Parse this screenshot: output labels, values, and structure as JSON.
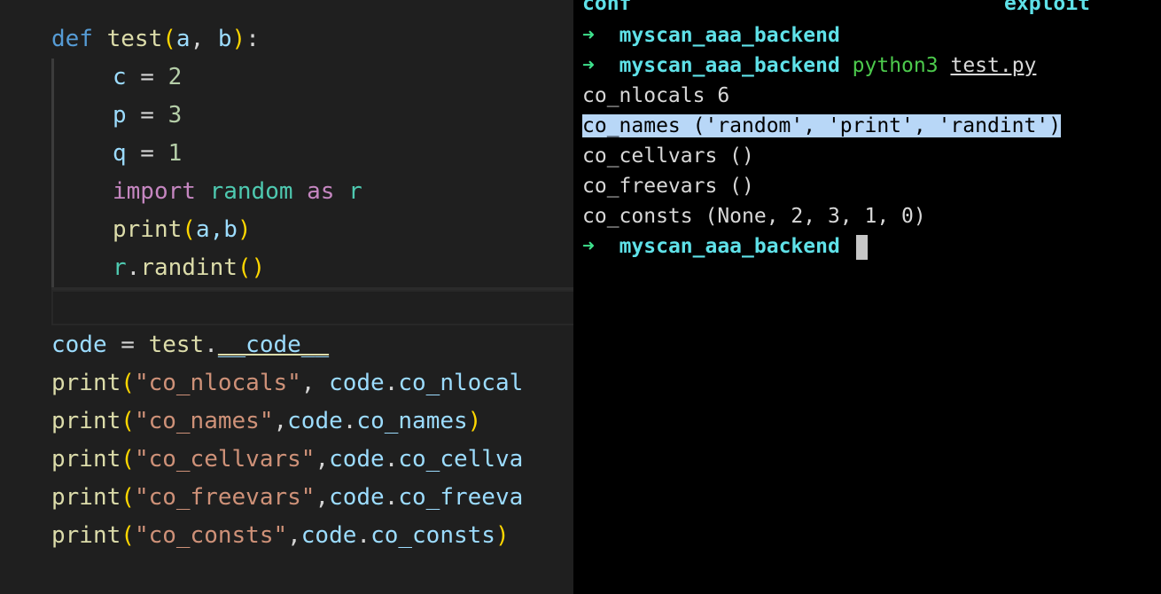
{
  "editor": {
    "def_kw": "def",
    "func_name": "test",
    "param_a": "a",
    "comma_space": ", ",
    "param_b": "b",
    "open_paren": "(",
    "close_paren": ")",
    "colon": ":",
    "lines": {
      "c_var": "c",
      "c_val": "2",
      "p_var": "p",
      "p_val": "3",
      "q_var": "q",
      "q_val": "1",
      "eq": " = ",
      "import_kw": "import",
      "module": "random",
      "as_kw": "as",
      "alias": "r",
      "print_fn": "print",
      "print_args": "a,b",
      "r_obj": "r",
      "randint": "randint"
    },
    "code_assign_var": "code",
    "code_assign_rhs_obj": "test",
    "code_assign_rhs_attr": "__code__",
    "prints": [
      {
        "str": "\"co_nlocals\"",
        "sep": ", ",
        "obj": "code",
        "attr": "co_nlocal"
      },
      {
        "str": "\"co_names\"",
        "sep": ",",
        "obj": "code",
        "attr": "co_names",
        "close": ")"
      },
      {
        "str": "\"co_cellvars\"",
        "sep": ",",
        "obj": "code",
        "attr": "co_cellva"
      },
      {
        "str": "\"co_freevars\"",
        "sep": ",",
        "obj": "code",
        "attr": "co_freeva"
      },
      {
        "str": "\"co_consts\"",
        "sep": ",",
        "obj": "code",
        "attr": "co_consts",
        "close": ")"
      }
    ]
  },
  "terminal": {
    "top_left": "conf",
    "top_right": "exploit",
    "prompt_arrow": "➜",
    "prompt_dir": "myscan_aaa_backend",
    "command": "python3",
    "command_arg": "test.py",
    "output": [
      "co_nlocals 6",
      "co_names ('random', 'print', 'randint')",
      "co_cellvars ()",
      "co_freevars ()",
      "co_consts (None, 2, 3, 1, 0)"
    ],
    "colors": {
      "background": "#000000",
      "prompt_arrow": "#3ee08c",
      "prompt_dir": "#5fe1e8",
      "selection": "#b8d7f7"
    }
  }
}
